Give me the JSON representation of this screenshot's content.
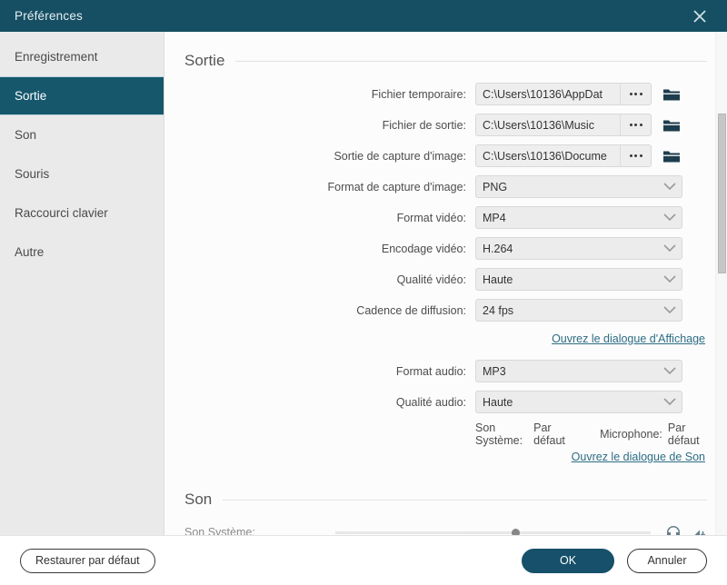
{
  "window": {
    "title": "Préférences",
    "close_icon": "close-icon",
    "accent_color": "#16506a",
    "titlebar_color": "#164f63",
    "link_color": "#2d6d84"
  },
  "sidebar": {
    "items": [
      {
        "label": "Enregistrement",
        "active": false
      },
      {
        "label": "Sortie",
        "active": true
      },
      {
        "label": "Son",
        "active": false
      },
      {
        "label": "Souris",
        "active": false
      },
      {
        "label": "Raccourci clavier",
        "active": false
      },
      {
        "label": "Autre",
        "active": false
      }
    ]
  },
  "sections": {
    "output": {
      "title": "Sortie",
      "paths": [
        {
          "label": "Fichier temporaire:",
          "value": "C:\\Users\\10136\\AppDat",
          "dots_label": "...",
          "folder_icon": "folder-icon"
        },
        {
          "label": "Fichier de sortie:",
          "value": "C:\\Users\\10136\\Music",
          "dots_label": "...",
          "folder_icon": "folder-icon"
        },
        {
          "label": "Sortie de capture d'image:",
          "value": "C:\\Users\\10136\\Docume",
          "dots_label": "...",
          "folder_icon": "folder-icon"
        }
      ],
      "selects": [
        {
          "label": "Format de capture d'image:",
          "value": "PNG"
        },
        {
          "label": "Format vidéo:",
          "value": "MP4"
        },
        {
          "label": "Encodage vidéo:",
          "value": "H.264"
        },
        {
          "label": "Qualité vidéo:",
          "value": "Haute"
        },
        {
          "label": "Cadence de diffusion:",
          "value": "24 fps"
        }
      ],
      "display_link": "Ouvrez le dialogue d'Affichage",
      "audio_selects": [
        {
          "label": "Format audio:",
          "value": "MP3"
        },
        {
          "label": "Qualité audio:",
          "value": "Haute"
        }
      ],
      "devices": {
        "system_sound_label": "Son Système:",
        "system_sound_value": "Par défaut",
        "microphone_label": "Microphone:",
        "microphone_value": "Par défaut"
      },
      "sound_link": "Ouvrez le dialogue de Son"
    },
    "sound": {
      "title": "Son",
      "row_label": "Son Système:",
      "headphone_icon": "headphone-icon",
      "speaker_icon": "speaker-icon"
    }
  },
  "footer": {
    "restore_label": "Restaurer par défaut",
    "ok_label": "OK",
    "cancel_label": "Annuler"
  }
}
